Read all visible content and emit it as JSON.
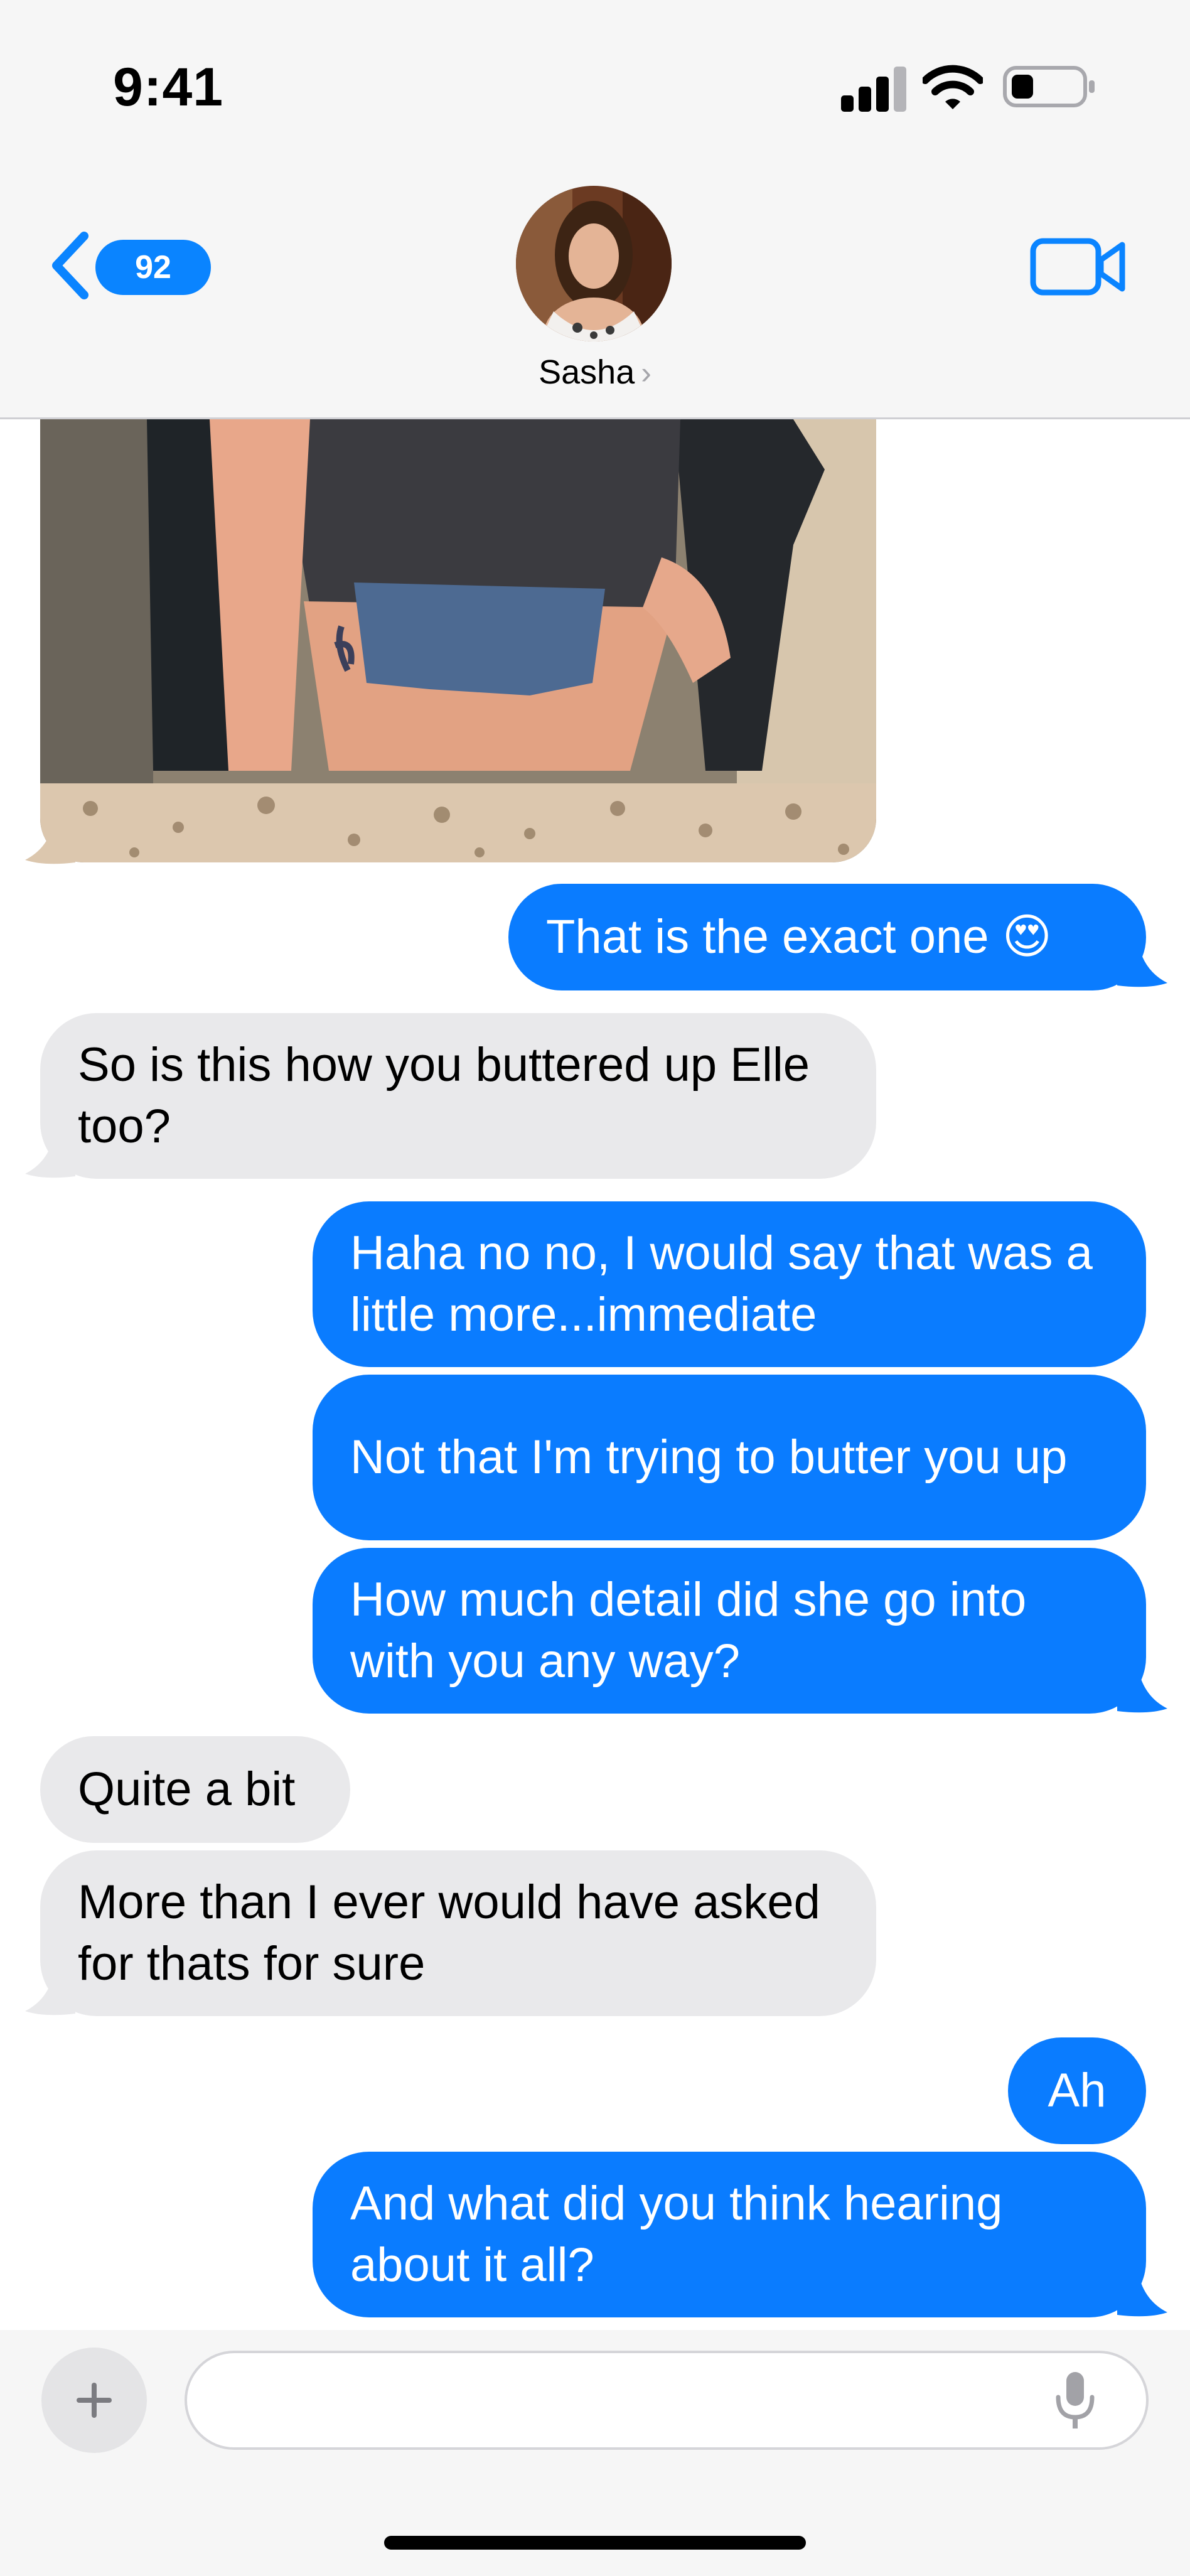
{
  "status_bar": {
    "time": "9:41"
  },
  "nav": {
    "back_count": "92",
    "contact_name": "Sasha"
  },
  "messages": [
    {
      "dir": "out",
      "text": "That is the exact one 😍"
    },
    {
      "dir": "in",
      "text": "So is this how you buttered up Elle too?"
    },
    {
      "dir": "out",
      "text": "Haha no no, I would say that was a little more...immediate"
    },
    {
      "dir": "out",
      "text": "Not that I'm trying to butter you up"
    },
    {
      "dir": "out",
      "text": "How much detail did she go into with you any way?"
    },
    {
      "dir": "in",
      "text": "Quite a bit"
    },
    {
      "dir": "in",
      "text": "More than I ever would have asked for thats for sure"
    },
    {
      "dir": "out",
      "text": "Ah"
    },
    {
      "dir": "out",
      "text": "And what did you think hearing about it all?"
    }
  ],
  "colors": {
    "accent": "#0a7cff",
    "incoming_bubble": "#e9e9eb",
    "header_bg": "#f6f6f6"
  },
  "icons": [
    "signal-icon",
    "wifi-icon",
    "battery-icon",
    "back-chevron-icon",
    "video-call-icon",
    "plus-icon",
    "microphone-icon"
  ]
}
